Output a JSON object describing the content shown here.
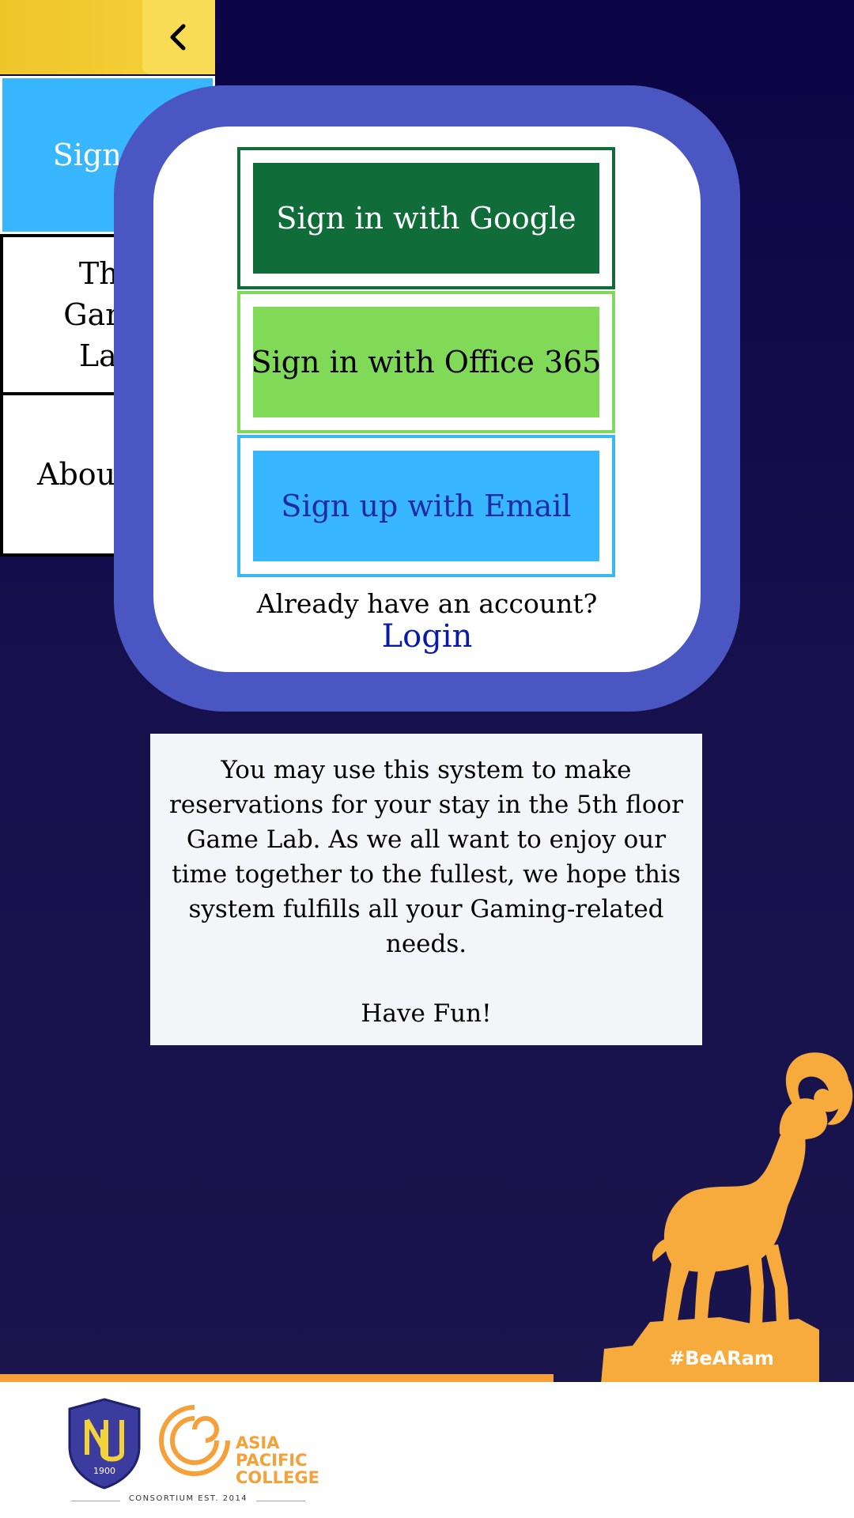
{
  "nav": {
    "back_icon": "chevron-left-icon",
    "menu": [
      {
        "label": "Sign In",
        "active": true
      },
      {
        "label": "The Game Lab",
        "active": false
      },
      {
        "label": "About Us",
        "active": false
      }
    ]
  },
  "auth": {
    "google_label": "Sign in with Google",
    "office_label": "Sign in with Office 365",
    "email_label": "Sign up with Email",
    "already_text": "Already have an account?",
    "login_label": "Login"
  },
  "info": {
    "message": "You may use this system to make reservations for your stay in the 5th floor Game Lab.  As we all want to enjoy our time together to the fullest, we hope this system fulfills all your Gaming-related needs.",
    "closing": "Have Fun!"
  },
  "mascot": {
    "hashtag": "#BeARam"
  },
  "footer": {
    "nu_year": "1900",
    "apc_line1": "ASIA",
    "apc_line2": "PACIFIC",
    "apc_line3": "COLLEGE",
    "consortium": "CONSORTIUM EST. 2014"
  },
  "colors": {
    "background": "#150f4c",
    "accent_yellow": "#f4d23b",
    "card_border": "#4a56c2",
    "google_green": "#106d39",
    "office_green": "#80d957",
    "email_blue": "#38b6ff",
    "ram_orange": "#f7ab3c"
  }
}
